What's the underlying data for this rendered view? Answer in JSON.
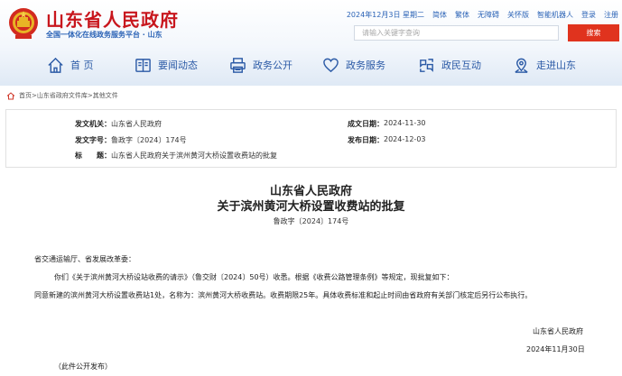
{
  "header": {
    "site_title": "山东省人民政府",
    "site_subtitle": "全国一体化在线政务服务平台 · 山东",
    "emblem_icon": "national-emblem-icon",
    "top_links": [
      "2024年12月3日 星期二",
      "简体",
      "繁体",
      "无障碍",
      "关怀版",
      "智能机器人",
      "登录",
      "注册"
    ],
    "search_placeholder": "请输入关键字查询",
    "search_button": "搜索"
  },
  "nav": [
    {
      "label": "首 页",
      "icon": "home-icon"
    },
    {
      "label": "要闻动态",
      "icon": "news-book-icon"
    },
    {
      "label": "政务公开",
      "icon": "printer-icon"
    },
    {
      "label": "政务服务",
      "icon": "heart-service-icon"
    },
    {
      "label": "政民互动",
      "icon": "interaction-icon"
    },
    {
      "label": "走进山东",
      "icon": "location-pin-icon"
    }
  ],
  "breadcrumb": {
    "icon": "home-outline-icon",
    "text": "首页>山东省政府文件库>其他文件"
  },
  "meta": {
    "issuer_label": "发文机关：",
    "issuer_value": "山东省人民政府",
    "number_label": "发文字号：",
    "number_value": "鲁政字〔2024〕174号",
    "title_label": "标　　题：",
    "title_value": "山东省人民政府关于滨州黄河大桥设置收费站的批复",
    "created_label": "成文日期：",
    "created_value": "2024-11-30",
    "published_label": "发布日期：",
    "published_value": "2024-12-03"
  },
  "document": {
    "issuer": "山东省人民政府",
    "title": "关于滨州黄河大桥设置收费站的批复",
    "doc_number": "鲁政字〔2024〕174号",
    "salutation": "省交通运输厅、省发展改革委：",
    "paragraph_1": "你们《关于滨州黄河大桥设站收费的请示》（鲁交财〔2024〕50号）收悉。根据《收费公路管理条例》等规定，现批复如下：",
    "paragraph_2": "同意新建的滨州黄河大桥设置收费站1处，名称为：滨州黄河大桥收费站。收费期限25年。具体收费标准和起止时间由省政府有关部门核定后另行公布执行。",
    "signature_org": "山东省人民政府",
    "signature_date": "2024年11月30日",
    "footer_note": "（此件公开发布）"
  }
}
